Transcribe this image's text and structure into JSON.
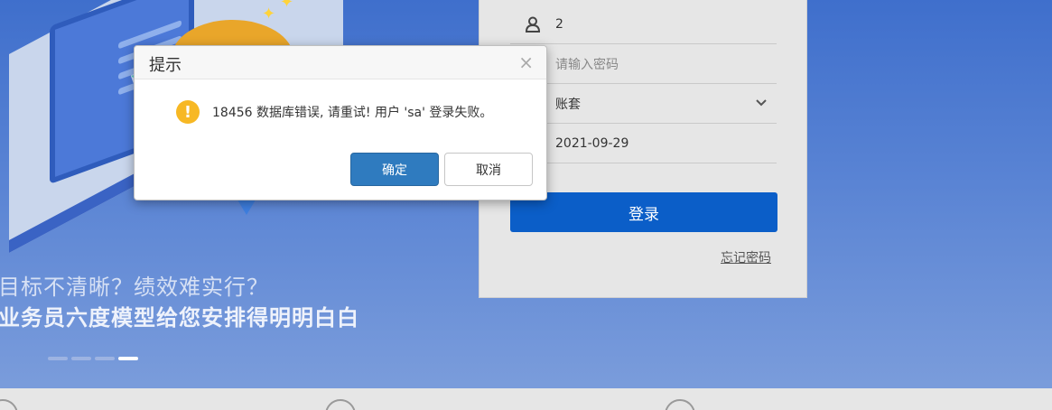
{
  "background": {
    "slogan_line1": "目标不清晰？绩效难实行？",
    "slogan_line2": "业务员六度模型给您安排得明明白白",
    "carousel_dots": 4,
    "carousel_active_index": 3
  },
  "login": {
    "username_value": "2",
    "password_placeholder": "请输入密码",
    "account_set_value": "账套",
    "date_value": "2021-09-29",
    "login_button": "登录",
    "forgot_password": "忘记密码"
  },
  "dialog": {
    "title": "提示",
    "close_glyph": "×",
    "warning_glyph": "!",
    "message": "18456 数据库错误, 请重试! 用户 'sa' 登录失败。",
    "ok_button": "确定",
    "cancel_button": "取消"
  },
  "colors": {
    "accent": "#0b5ec8",
    "dialog_ok": "#2f7bbf",
    "warning": "#f7b824"
  }
}
